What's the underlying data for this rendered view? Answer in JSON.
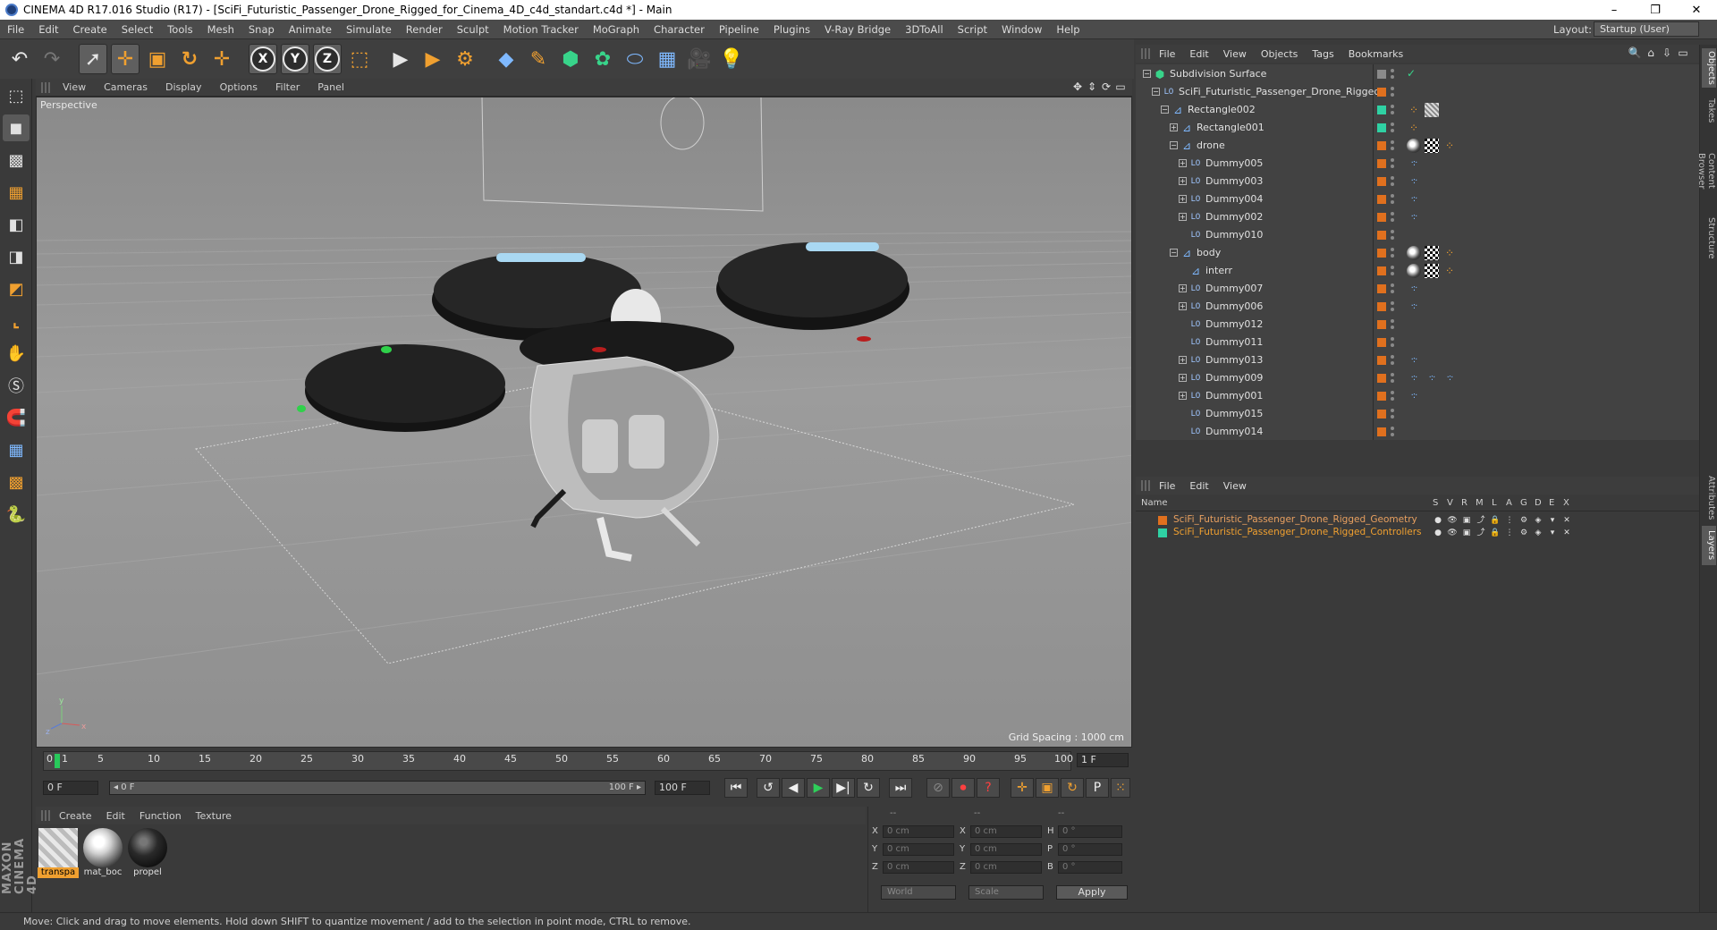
{
  "window": {
    "title": "CINEMA 4D R17.016 Studio (R17) - [SciFi_Futuristic_Passenger_Drone_Rigged_for_Cinema_4D_c4d_standart.c4d *] - Main",
    "minimize": "–",
    "maximize": "❐",
    "close": "✕"
  },
  "menubar": {
    "items": [
      "File",
      "Edit",
      "Create",
      "Select",
      "Tools",
      "Mesh",
      "Snap",
      "Animate",
      "Simulate",
      "Render",
      "Sculpt",
      "Motion Tracker",
      "MoGraph",
      "Character",
      "Pipeline",
      "Plugins",
      "V-Ray Bridge",
      "3DToAll",
      "Script",
      "Window",
      "Help"
    ],
    "layout_label": "Layout:",
    "layout_value": "Startup (User)"
  },
  "toolbar": {
    "undo_icon": "↶",
    "redo_icon": "↷",
    "select_icon": "➚",
    "move_icon": "✛",
    "scale_icon": "▣",
    "rotate_icon": "↻",
    "last_tool_icon": "✛",
    "axis_x": "X",
    "axis_y": "Y",
    "axis_z": "Z",
    "coord_icon": "⬚",
    "render_view_icon": "▶",
    "render_pv_icon": "▶",
    "render_settings_icon": "⚙",
    "cube_icon": "◆",
    "pen_icon": "✎",
    "subdiv_icon": "⬢",
    "array_icon": "✿",
    "deformer_icon": "⬭",
    "floor_icon": "▦",
    "camera_icon": "🎥",
    "light_icon": "💡"
  },
  "leftbar": {
    "icons": [
      "⬚",
      "◼",
      "▩",
      "▦",
      "◧",
      "◨",
      "◩",
      "⌞",
      "✋",
      "Ⓢ",
      "🧲",
      "▦",
      "▩",
      "🐍"
    ],
    "logo": "MAXON CINEMA 4D"
  },
  "viewport": {
    "menu": [
      "View",
      "Cameras",
      "Display",
      "Options",
      "Filter",
      "Panel"
    ],
    "nav_icons": [
      "✥",
      "⇕",
      "⟳",
      "▭"
    ],
    "label": "Perspective",
    "grid_spacing": "Grid Spacing : 1000 cm"
  },
  "timeline": {
    "ticks": [
      "0",
      "5",
      "10",
      "15",
      "20",
      "25",
      "30",
      "35",
      "40",
      "45",
      "50",
      "55",
      "60",
      "65",
      "70",
      "75",
      "80",
      "85",
      "90",
      "95",
      "100"
    ],
    "playhead_label": "1",
    "current_frame": "1 F"
  },
  "transport": {
    "start_field": "0 F",
    "range_start": "◂ 0 F",
    "range_end": "100 F ▸",
    "end_field": "100 F",
    "buttons": {
      "first": "⏮",
      "prev_key": "↺",
      "prev": "◀",
      "play": "▶",
      "next": "▶|",
      "next_key": "↻",
      "last": "⏭",
      "rec_off": "⊘",
      "rec": "⏺",
      "autokey": "?",
      "move": "✛",
      "scale": "▣",
      "rotate": "↻",
      "param": "P",
      "grid": "⁙",
      "timeline": "▦"
    }
  },
  "materials": {
    "menu": [
      "Create",
      "Edit",
      "Function",
      "Texture"
    ],
    "items": [
      {
        "label": "transpa",
        "kind": "transparent"
      },
      {
        "label": "mat_boc",
        "kind": "white"
      },
      {
        "label": "propel",
        "kind": "black"
      }
    ]
  },
  "coordinates": {
    "headers": [
      "--",
      "--",
      "--"
    ],
    "rows": [
      {
        "l1": "X",
        "v1": "0 cm",
        "l2": "X",
        "v2": "0 cm",
        "l3": "H",
        "v3": "0 °"
      },
      {
        "l1": "Y",
        "v1": "0 cm",
        "l2": "Y",
        "v2": "0 cm",
        "l3": "P",
        "v3": "0 °"
      },
      {
        "l1": "Z",
        "v1": "0 cm",
        "l2": "Z",
        "v2": "0 cm",
        "l3": "B",
        "v3": "0 °"
      }
    ],
    "space_select": "World",
    "mode_select": "Scale",
    "apply": "Apply"
  },
  "status": "Move: Click and drag to move elements. Hold down SHIFT to quantize movement / add to the selection in point mode, CTRL to remove.",
  "object_manager": {
    "menu": [
      "File",
      "Edit",
      "View",
      "Objects",
      "Tags",
      "Bookmarks"
    ],
    "icons": [
      "🔍",
      "⌂",
      "⇩",
      "▭"
    ],
    "rows": [
      {
        "name": "Subdivision Surface",
        "depth": 0,
        "toggle": "−",
        "icon": "⬢",
        "icon_color": "#38d48a",
        "layer": "#8a8a8a",
        "tags": [
          "check"
        ]
      },
      {
        "name": "SciFi_Futuristic_Passenger_Drone_Rigged",
        "depth": 1,
        "toggle": "−",
        "icon": "L0",
        "icon_color": "#9fc6ff",
        "layer": "#e0701e",
        "tags": []
      },
      {
        "name": "Rectangle002",
        "depth": 2,
        "toggle": "−",
        "icon": "⊿",
        "icon_color": "#7fb9ff",
        "layer": "#2fd1a3",
        "tags": [
          "ik",
          "hatch"
        ]
      },
      {
        "name": "Rectangle001",
        "depth": 3,
        "toggle": "+",
        "icon": "⊿",
        "icon_color": "#7fb9ff",
        "layer": "#2fd1a3",
        "tags": [
          "ik"
        ]
      },
      {
        "name": "drone",
        "depth": 3,
        "toggle": "−",
        "icon": "⊿",
        "icon_color": "#7fb9ff",
        "layer": "#e0701e",
        "tags": [
          "phong",
          "checker",
          "ik"
        ]
      },
      {
        "name": "Dummy005",
        "depth": 4,
        "toggle": "+",
        "icon": "L0",
        "icon_color": "#9fc6ff",
        "layer": "#e0701e",
        "tags": [
          "xp"
        ]
      },
      {
        "name": "Dummy003",
        "depth": 4,
        "toggle": "+",
        "icon": "L0",
        "icon_color": "#9fc6ff",
        "layer": "#e0701e",
        "tags": [
          "xp"
        ]
      },
      {
        "name": "Dummy004",
        "depth": 4,
        "toggle": "+",
        "icon": "L0",
        "icon_color": "#9fc6ff",
        "layer": "#e0701e",
        "tags": [
          "xp"
        ]
      },
      {
        "name": "Dummy002",
        "depth": 4,
        "toggle": "+",
        "icon": "L0",
        "icon_color": "#9fc6ff",
        "layer": "#e0701e",
        "tags": [
          "xp"
        ]
      },
      {
        "name": "Dummy010",
        "depth": 4,
        "toggle": "",
        "icon": "L0",
        "icon_color": "#9fc6ff",
        "layer": "#e0701e",
        "tags": []
      },
      {
        "name": "body",
        "depth": 3,
        "toggle": "−",
        "icon": "⊿",
        "icon_color": "#7fb9ff",
        "layer": "#e0701e",
        "tags": [
          "phong",
          "checker",
          "ik"
        ]
      },
      {
        "name": "interr",
        "depth": 4,
        "toggle": "",
        "icon": "⊿",
        "icon_color": "#7fb9ff",
        "layer": "#e0701e",
        "tags": [
          "phong",
          "checker",
          "ik"
        ]
      },
      {
        "name": "Dummy007",
        "depth": 4,
        "toggle": "+",
        "icon": "L0",
        "icon_color": "#9fc6ff",
        "layer": "#e0701e",
        "tags": [
          "xp"
        ]
      },
      {
        "name": "Dummy006",
        "depth": 4,
        "toggle": "+",
        "icon": "L0",
        "icon_color": "#9fc6ff",
        "layer": "#e0701e",
        "tags": [
          "xp"
        ]
      },
      {
        "name": "Dummy012",
        "depth": 4,
        "toggle": "",
        "icon": "L0",
        "icon_color": "#9fc6ff",
        "layer": "#e0701e",
        "tags": []
      },
      {
        "name": "Dummy011",
        "depth": 4,
        "toggle": "",
        "icon": "L0",
        "icon_color": "#9fc6ff",
        "layer": "#e0701e",
        "tags": []
      },
      {
        "name": "Dummy013",
        "depth": 4,
        "toggle": "+",
        "icon": "L0",
        "icon_color": "#9fc6ff",
        "layer": "#e0701e",
        "tags": [
          "xp"
        ]
      },
      {
        "name": "Dummy009",
        "depth": 4,
        "toggle": "+",
        "icon": "L0",
        "icon_color": "#9fc6ff",
        "layer": "#e0701e",
        "tags": [
          "xp",
          "xp",
          "xp"
        ]
      },
      {
        "name": "Dummy001",
        "depth": 4,
        "toggle": "+",
        "icon": "L0",
        "icon_color": "#9fc6ff",
        "layer": "#e0701e",
        "tags": [
          "xp"
        ]
      },
      {
        "name": "Dummy015",
        "depth": 4,
        "toggle": "",
        "icon": "L0",
        "icon_color": "#9fc6ff",
        "layer": "#e0701e",
        "tags": []
      },
      {
        "name": "Dummy014",
        "depth": 4,
        "toggle": "",
        "icon": "L0",
        "icon_color": "#9fc6ff",
        "layer": "#e0701e",
        "tags": []
      }
    ]
  },
  "layer_manager": {
    "menu": [
      "File",
      "Edit",
      "View"
    ],
    "columns": [
      "Name",
      "S",
      "V",
      "R",
      "M",
      "L",
      "A",
      "G",
      "D",
      "E",
      "X"
    ],
    "rows": [
      {
        "name": "SciFi_Futuristic_Passenger_Drone_Rigged_Geometry",
        "color": "#e0701e",
        "text_color": "#e8a060"
      },
      {
        "name": "SciFi_Futuristic_Passenger_Drone_Rigged_Controllers",
        "color": "#2fd1a3",
        "text_color": "#f0a030"
      }
    ],
    "row_icons": [
      "●",
      "👁",
      "▣",
      "⤴",
      "🔒",
      "⋮",
      "⚙",
      "◈",
      "▾",
      "✕"
    ]
  },
  "side_tabs": [
    "Objects",
    "Takes",
    "Content Browser",
    "Structure",
    "Attributes",
    "Layers"
  ],
  "colors": {
    "accent": "#f0a030",
    "playhead": "#28c95b",
    "bg": "#3a3a3a"
  }
}
